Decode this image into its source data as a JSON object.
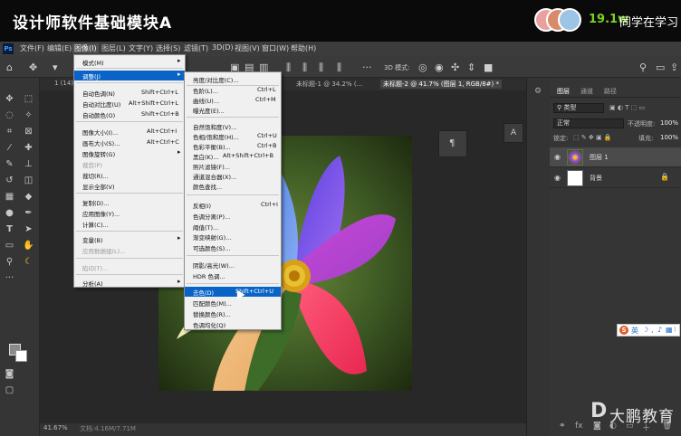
{
  "header": {
    "course_title": "设计师软件基础模块A",
    "viewers": "19.1w",
    "learning_label": "同学在学习"
  },
  "ps_logo": "Ps",
  "menubar": {
    "items": [
      "文件(F)",
      "编辑(E)",
      "图像(I)",
      "图层(L)",
      "文字(Y)",
      "选择(S)",
      "滤镜(T)",
      "3D(D)",
      "视图(V)",
      "窗口(W)",
      "帮助(H)"
    ]
  },
  "options_bar": {
    "mode_3d": "3D 模式:"
  },
  "doc_tabs": {
    "tab1": "1 (14).jp",
    "tab2": "未标题-1 @ 34.2% (...",
    "tab3": "未标题-2 @ 41.7% (图层 1, RGB/8#) *"
  },
  "status": {
    "zoom": "41.67%",
    "file": "文档:4.16M/7.71M"
  },
  "image_menu": {
    "items": [
      {
        "label": "模式(M)",
        "shortcut": "",
        "submenu": true
      },
      {
        "label": "调整(J)",
        "shortcut": "",
        "submenu": true,
        "highlight": true
      },
      {
        "label": "自动色调(N)",
        "shortcut": "Shift+Ctrl+L"
      },
      {
        "label": "自动对比度(U)",
        "shortcut": "Alt+Shift+Ctrl+L"
      },
      {
        "label": "自动颜色(O)",
        "shortcut": "Shift+Ctrl+B"
      },
      {
        "label": "图像大小(I)...",
        "shortcut": "Alt+Ctrl+I"
      },
      {
        "label": "画布大小(S)...",
        "shortcut": "Alt+Ctrl+C"
      },
      {
        "label": "图像旋转(G)",
        "shortcut": "",
        "submenu": true
      },
      {
        "label": "裁剪(P)",
        "shortcut": "",
        "disabled": true
      },
      {
        "label": "裁切(R)...",
        "shortcut": ""
      },
      {
        "label": "显示全部(V)",
        "shortcut": ""
      },
      {
        "label": "复制(D)...",
        "shortcut": ""
      },
      {
        "label": "应用图像(Y)...",
        "shortcut": ""
      },
      {
        "label": "计算(C)...",
        "shortcut": ""
      },
      {
        "label": "变量(B)",
        "shortcut": "",
        "submenu": true
      },
      {
        "label": "应用数据组(L)...",
        "shortcut": "",
        "disabled": true
      },
      {
        "label": "陷印(T)...",
        "shortcut": "",
        "disabled": true
      },
      {
        "label": "分析(A)",
        "shortcut": "",
        "submenu": true
      }
    ]
  },
  "adjust_menu": {
    "items": [
      {
        "label": "亮度/对比度(C)...",
        "shortcut": ""
      },
      {
        "label": "色阶(L)...",
        "shortcut": "Ctrl+L"
      },
      {
        "label": "曲线(U)...",
        "shortcut": "Ctrl+M"
      },
      {
        "label": "曝光度(E)...",
        "shortcut": ""
      },
      {
        "label": "自然饱和度(V)...",
        "shortcut": ""
      },
      {
        "label": "色相/饱和度(H)...",
        "shortcut": "Ctrl+U"
      },
      {
        "label": "色彩平衡(B)...",
        "shortcut": "Ctrl+B"
      },
      {
        "label": "黑白(K)...",
        "shortcut": "Alt+Shift+Ctrl+B"
      },
      {
        "label": "照片滤镜(F)...",
        "shortcut": ""
      },
      {
        "label": "通道混合器(X)...",
        "shortcut": ""
      },
      {
        "label": "颜色查找...",
        "shortcut": ""
      },
      {
        "label": "反相(I)",
        "shortcut": "Ctrl+I"
      },
      {
        "label": "色调分离(P)...",
        "shortcut": ""
      },
      {
        "label": "阈值(T)...",
        "shortcut": ""
      },
      {
        "label": "渐变映射(G)...",
        "shortcut": ""
      },
      {
        "label": "可选颜色(S)...",
        "shortcut": ""
      },
      {
        "label": "阴影/高光(W)...",
        "shortcut": ""
      },
      {
        "label": "HDR 色调...",
        "shortcut": ""
      },
      {
        "label": "去色(D)",
        "shortcut": "Shift+Ctrl+U",
        "highlight": true
      },
      {
        "label": "匹配颜色(M)...",
        "shortcut": ""
      },
      {
        "label": "替换颜色(R)...",
        "shortcut": ""
      },
      {
        "label": "色调均化(Q)",
        "shortcut": ""
      }
    ]
  },
  "layers_panel": {
    "tabs": [
      "图层",
      "通道",
      "路径"
    ],
    "filter_kind": "类型",
    "blend_mode": "正常",
    "opacity_label": "不透明度:",
    "opacity_value": "100%",
    "lock_label": "锁定:",
    "fill_label": "填充:",
    "fill_value": "100%",
    "layers": [
      {
        "name": "图层 1",
        "selected": true
      },
      {
        "name": "背景",
        "selected": false
      }
    ]
  },
  "ime": {
    "letter": "S",
    "mode": "英"
  },
  "watermark": {
    "text": "大鹏教育"
  }
}
